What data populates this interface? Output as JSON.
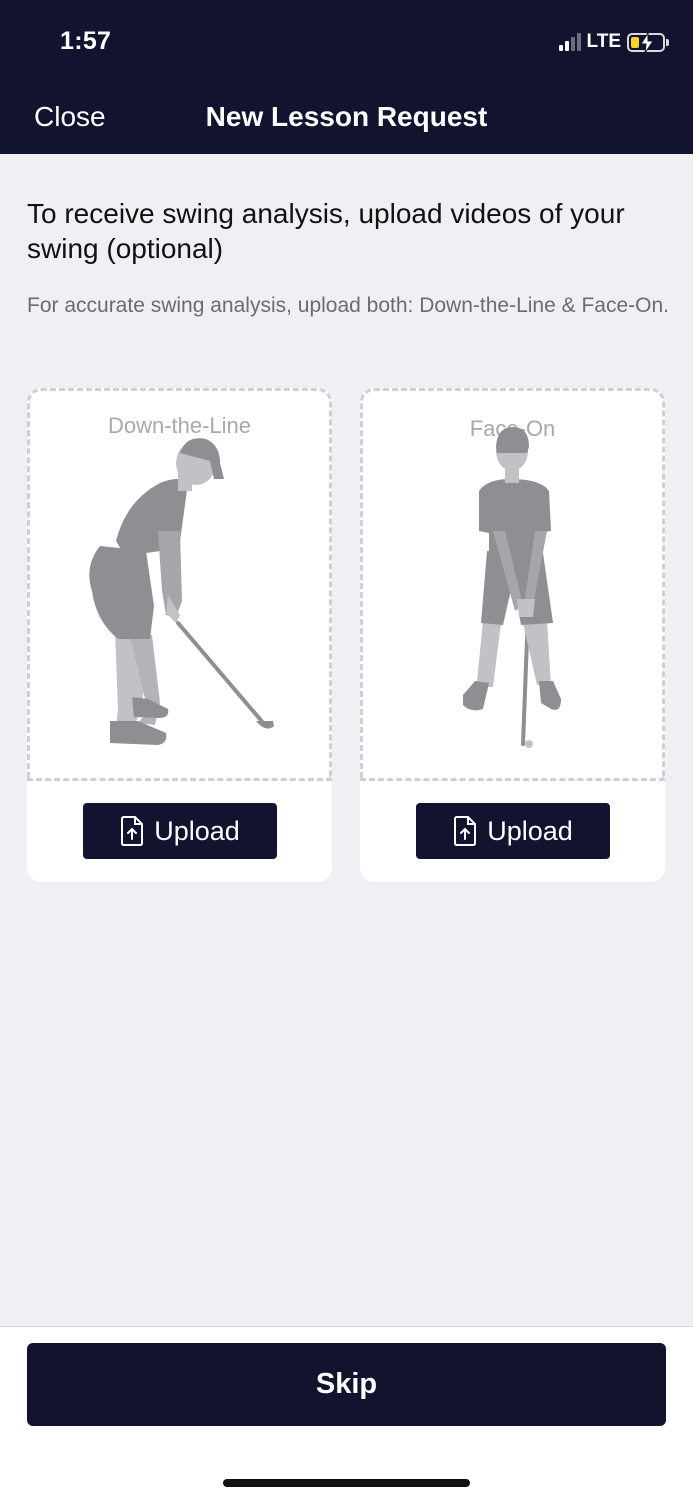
{
  "status_bar": {
    "time": "1:57",
    "network": "LTE",
    "battery_level": 0.25,
    "battery_charging": true,
    "signal_bars": 2
  },
  "nav": {
    "close_label": "Close",
    "title": "New Lesson Request"
  },
  "content": {
    "heading": "To receive swing analysis, upload videos of your swing (optional)",
    "subtext": "For accurate swing analysis, upload both: Down-the-Line & Face-On."
  },
  "cards": [
    {
      "label": "Down-the-Line",
      "button_label": "Upload",
      "icon": "file-upload-icon"
    },
    {
      "label": "Face-On",
      "button_label": "Upload",
      "icon": "file-upload-icon"
    }
  ],
  "footer": {
    "skip_label": "Skip"
  },
  "colors": {
    "navy": "#11132f",
    "background": "#efeff4",
    "silhouette_dark": "#8e8e93",
    "silhouette_light": "#c2c2c6"
  }
}
